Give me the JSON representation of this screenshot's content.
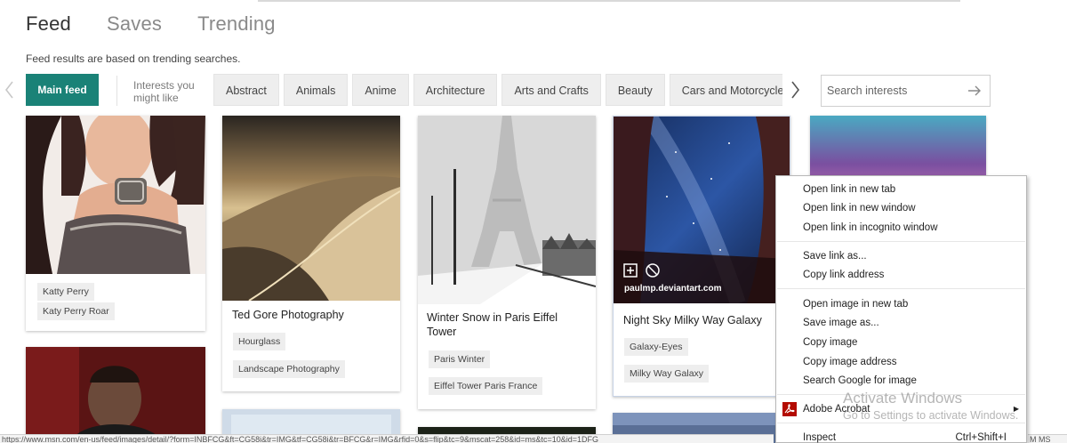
{
  "nav": {
    "tabs": [
      "Feed",
      "Saves",
      "Trending"
    ]
  },
  "subtitle": "Feed results are based on trending searches.",
  "interests": {
    "main_feed": "Main feed",
    "label_line1": "Interests you",
    "label_line2": "might like",
    "chips": [
      "Abstract",
      "Animals",
      "Anime",
      "Architecture",
      "Arts and Crafts",
      "Beauty",
      "Cars and Motorcycles"
    ],
    "search_placeholder": "Search interests"
  },
  "cards": {
    "c1": {
      "tags": [
        "Katty Perry",
        "Katy Perry Roar"
      ]
    },
    "c2": {
      "title": "Ted Gore Photography",
      "tags": [
        "Hourglass",
        "Landscape Photography"
      ]
    },
    "c3": {
      "title": "Winter Snow in Paris Eiffel Tower",
      "tags": [
        "Paris Winter",
        "Eiffel Tower Paris France"
      ]
    },
    "c4": {
      "title": "Night Sky Milky Way Galaxy",
      "tags": [
        "Galaxy-Eyes",
        "Milky Way Galaxy"
      ],
      "credit": "paulmp.deviantart.com"
    }
  },
  "context_menu": {
    "items": [
      "Open link in new tab",
      "Open link in new window",
      "Open link in incognito window",
      "Save link as...",
      "Copy link address",
      "Open image in new tab",
      "Save image as...",
      "Copy image",
      "Copy image address",
      "Search Google for image",
      "Adobe Acrobat",
      "Inspect"
    ],
    "inspect_shortcut": "Ctrl+Shift+I"
  },
  "watermark": {
    "line1": "Activate Windows",
    "line2": "Go to Settings to activate Windows."
  },
  "statusbar": {
    "text": "https://www.msn.com/en-us/feed/images/detail/?form=INBFCG&ft=CG58i&tr=IMG&tf=CG58i&tr=BFCG&r=IMG&rfid=0&s=flip&tc=9&mscat=258&id=ms&tc=10&id=1DFG",
    "right": "M MS"
  },
  "colors": {
    "accent": "#1a8277",
    "chip_bg": "#eeeeee"
  }
}
